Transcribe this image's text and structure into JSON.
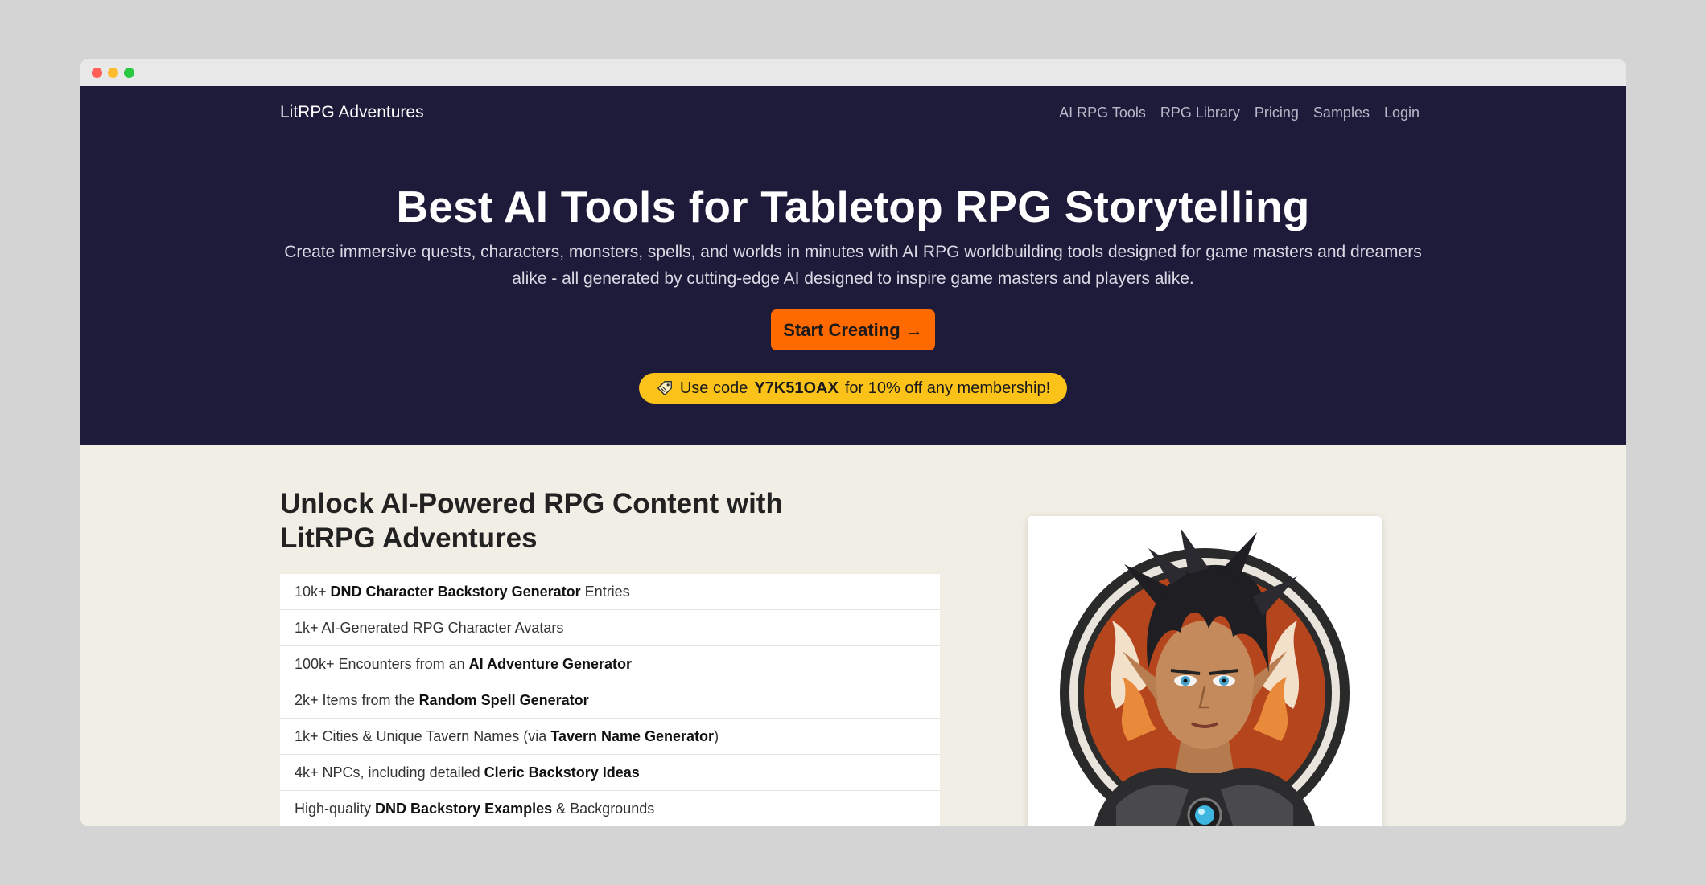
{
  "window": {
    "controls": [
      "close",
      "minimize",
      "maximize"
    ]
  },
  "nav": {
    "brand": "LitRPG Adventures",
    "links": [
      "AI RPG Tools",
      "RPG Library",
      "Pricing",
      "Samples",
      "Login"
    ]
  },
  "hero": {
    "title": "Best AI Tools for Tabletop RPG Storytelling",
    "subtitle": "Create immersive quests, characters, monsters, spells, and worlds in minutes with AI RPG worldbuilding tools designed for game masters and dreamers alike - all generated by cutting-edge AI designed to inspire game masters and players alike.",
    "cta_label": "Start Creating →",
    "promo_prefix": "Use code",
    "promo_code": "Y7K51OAX",
    "promo_suffix": "for 10% off any membership!",
    "promo_icon": "tag-icon"
  },
  "features": {
    "title": "Unlock AI-Powered RPG Content with LitRPG Adventures",
    "items": [
      {
        "pre": "10k+",
        "bold": "DND Character Backstory Generator",
        "post": "Entries"
      },
      {
        "pre": "1k+ AI-Generated RPG Character Avatars",
        "bold": "",
        "post": ""
      },
      {
        "pre": "100k+ Encounters from an",
        "bold": "AI Adventure Generator",
        "post": ""
      },
      {
        "pre": "2k+ Items from the",
        "bold": "Random Spell Generator",
        "post": ""
      },
      {
        "pre": "1k+ Cities & Unique Tavern Names (via",
        "bold": "Tavern Name Generator",
        "post": ")"
      },
      {
        "pre": "4k+ NPCs, including detailed",
        "bold": "Cleric Backstory Ideas",
        "post": ""
      },
      {
        "pre": "High-quality",
        "bold": "DND Backstory Examples",
        "post": "& Backgrounds"
      }
    ]
  },
  "colors": {
    "hero_bg": "#1e1b3a",
    "cta": "#ff6a00",
    "promo": "#fbc21a",
    "page_bg": "#f1efe5"
  }
}
